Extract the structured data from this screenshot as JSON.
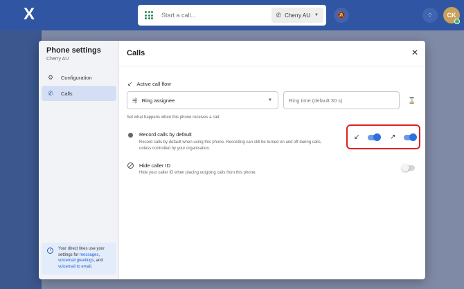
{
  "topbar": {
    "logo": "X",
    "call_placeholder": "Start a call...",
    "line_select": "Cherry AU",
    "avatar_initials": "CK"
  },
  "sidebar": {
    "title": "Phone settings",
    "subtitle": "Cherry AU",
    "items": [
      {
        "label": "Configuration",
        "icon": "gear-icon",
        "active": false
      },
      {
        "label": "Calls",
        "icon": "phone-icon",
        "active": true
      }
    ],
    "info": {
      "text_before": "Your direct lines use your settings for",
      "link_messages": "messages",
      "comma": ",",
      "link_greetings": "voicemail greetings",
      "and": ", and",
      "link_email": "voicemail to email",
      "period": "."
    }
  },
  "main": {
    "title": "Calls",
    "active_call_flow": {
      "label": "Active call flow",
      "select_value": "Ring assignee",
      "ring_time_placeholder": "Ring time (default 30 s)",
      "helper": "Set what happens when this phone receives a call."
    },
    "record_calls": {
      "title": "Record calls by default",
      "description": "Record calls by default when using this phone. Recording can still be turned on and off during calls, unless controlled by your organisation.",
      "inbound_on": true,
      "outbound_on": true
    },
    "hide_caller_id": {
      "title": "Hide caller ID",
      "description": "Hide your caller ID when placing outgoing calls from this phone.",
      "on": false
    }
  },
  "colors": {
    "brand": "#2f55a3",
    "toggle_on": "#2f6fe0",
    "highlight": "#e02020"
  }
}
